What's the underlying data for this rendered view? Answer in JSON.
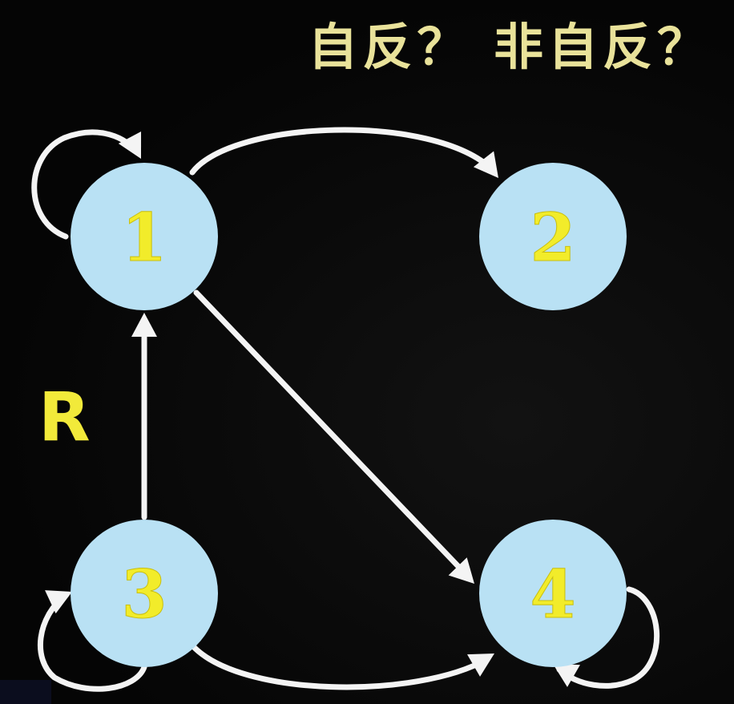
{
  "title": "自反？ 非自反？",
  "relation_label": "R",
  "nodes": [
    {
      "id": "1",
      "label": "1"
    },
    {
      "id": "2",
      "label": "2"
    },
    {
      "id": "3",
      "label": "3"
    },
    {
      "id": "4",
      "label": "4"
    }
  ],
  "edges": [
    {
      "from": "1",
      "to": "1",
      "type": "self-loop"
    },
    {
      "from": "1",
      "to": "2",
      "type": "arc"
    },
    {
      "from": "1",
      "to": "4",
      "type": "straight"
    },
    {
      "from": "3",
      "to": "1",
      "type": "straight"
    },
    {
      "from": "3",
      "to": "3",
      "type": "self-loop"
    },
    {
      "from": "3",
      "to": "4",
      "type": "arc"
    },
    {
      "from": "4",
      "to": "4",
      "type": "self-loop"
    }
  ],
  "colors": {
    "background": "#050505",
    "node_fill": "#b9e1f4",
    "node_label": "#f2ec2a",
    "title": "#e9e29a",
    "relation_label": "#f2ea3a",
    "edge": "#f4f4f4"
  }
}
